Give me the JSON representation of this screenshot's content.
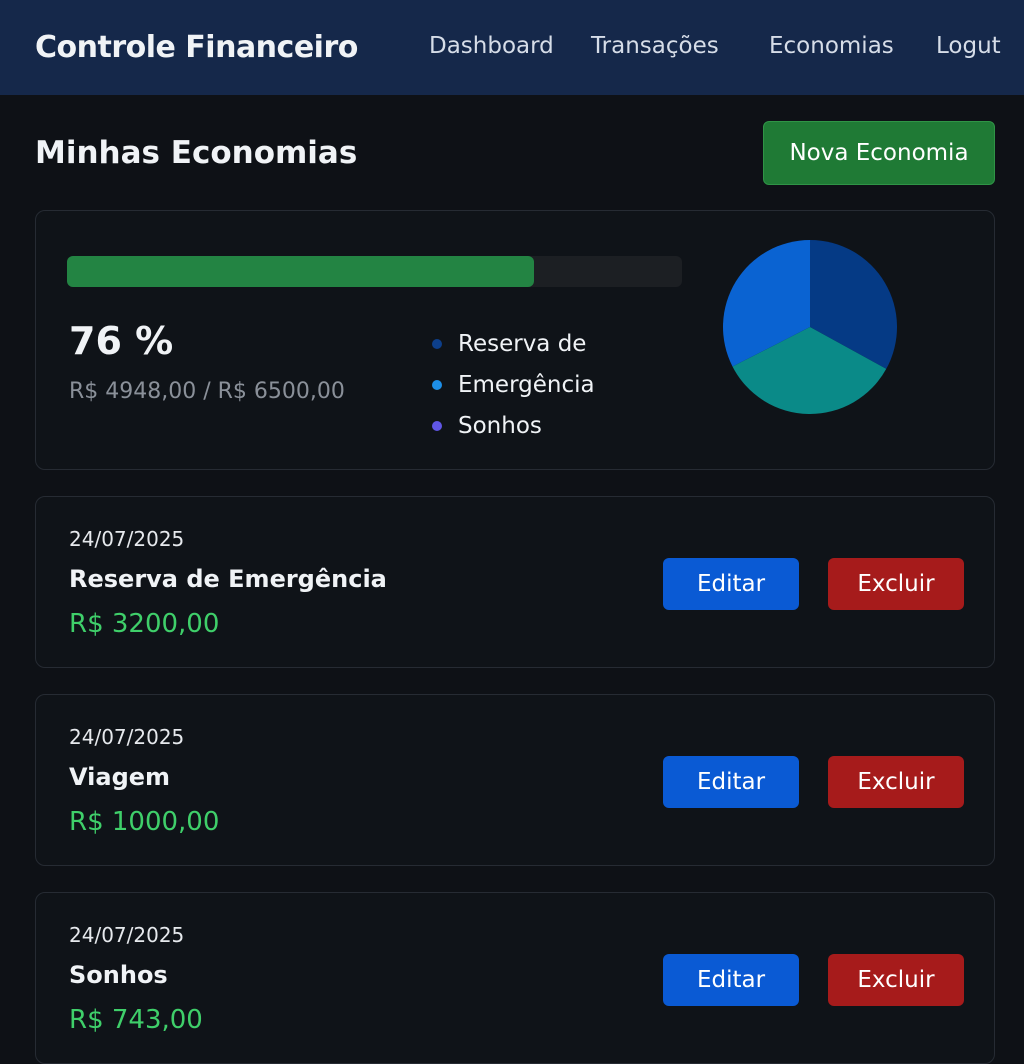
{
  "nav": {
    "brand": "Controle Financeiro",
    "links": [
      "Dashboard",
      "Transações",
      "Economias",
      "Logut"
    ]
  },
  "page": {
    "title": "Minhas Economias",
    "new_button": "Nova Economia"
  },
  "summary": {
    "progress_percent": 76,
    "percent_label": "76 %",
    "amount_label": "R$ 4948,00 / R$ 6500,00",
    "legend": [
      {
        "label": "Reserva de",
        "color": "#0d3f8a"
      },
      {
        "label": "Emergência",
        "color": "#1d8fe8"
      },
      {
        "label": "Sonhos",
        "color": "#6056e6"
      }
    ],
    "pie": [
      {
        "fraction": 0.33,
        "color": "#053a85"
      },
      {
        "fraction": 0.345,
        "color": "#0a8a88"
      },
      {
        "fraction": 0.325,
        "color": "#0a63d2"
      }
    ]
  },
  "items": [
    {
      "date": "24/07/2025",
      "name": "Reserva de Emergência",
      "value": "R$ 3200,00"
    },
    {
      "date": "24/07/2025",
      "name": "Viagem",
      "value": "R$ 1000,00"
    },
    {
      "date": "24/07/2025",
      "name": "Sonhos",
      "value": "R$ 743,00"
    }
  ],
  "actions": {
    "edit": "Editar",
    "delete": "Excluir"
  }
}
